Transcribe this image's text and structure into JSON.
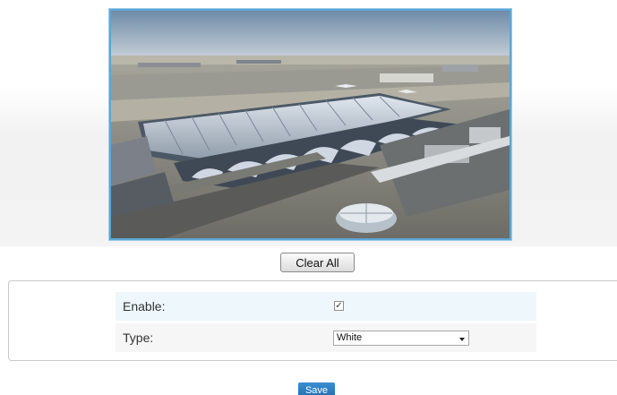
{
  "preview": {
    "image_alt": "Camera live view: airport terminal aerial"
  },
  "toolbar": {
    "clear_all_label": "Clear All"
  },
  "settings": {
    "enable": {
      "label": "Enable:",
      "checked": true
    },
    "type": {
      "label": "Type:",
      "value": "White"
    }
  },
  "actions": {
    "save_label": "Save"
  },
  "colors": {
    "frame_border": "#5aa6d6",
    "save_button": "#2a7ec6",
    "enable_row_bg": "#eef7fc",
    "type_row_bg": "#f6f6f6"
  }
}
